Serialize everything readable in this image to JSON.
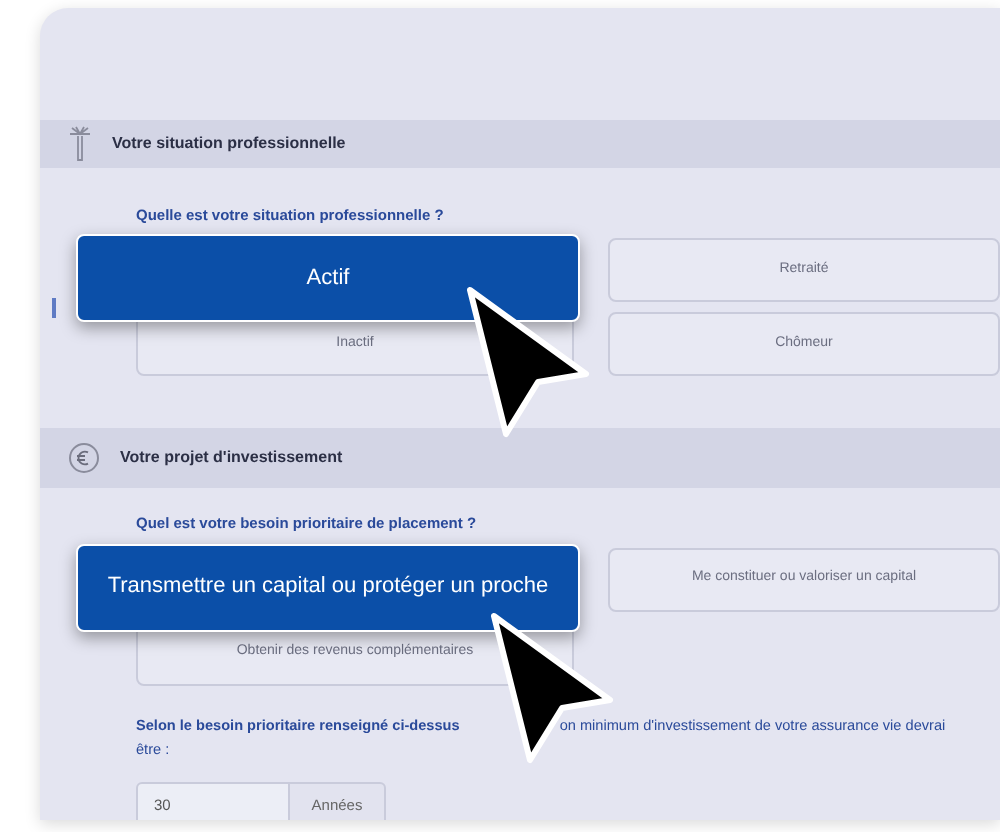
{
  "sections": [
    {
      "title": "Votre situation professionnelle",
      "question": "Quelle est votre situation professionnelle ?",
      "options": [
        {
          "label": "Actif",
          "selected": true
        },
        {
          "label": "Retraité",
          "selected": false
        },
        {
          "label": "Inactif",
          "selected": false
        },
        {
          "label": "Chômeur",
          "selected": false
        }
      ]
    },
    {
      "title": "Votre projet d'investissement",
      "question": "Quel est votre besoin prioritaire de placement ?",
      "options": [
        {
          "label": "Transmettre un capital ou protéger un proche",
          "selected": true
        },
        {
          "label": "Me constituer ou valoriser un capital",
          "selected": false
        },
        {
          "label": "Obtenir des revenus complémentaires",
          "selected": false
        }
      ],
      "note_parts": [
        "Selon le besoin prioritaire renseigné ci-dessus",
        "on minimum d'investissement de votre assurance vie devrai",
        "être :"
      ],
      "duration": {
        "value": "30",
        "unit": "Années"
      }
    }
  ]
}
